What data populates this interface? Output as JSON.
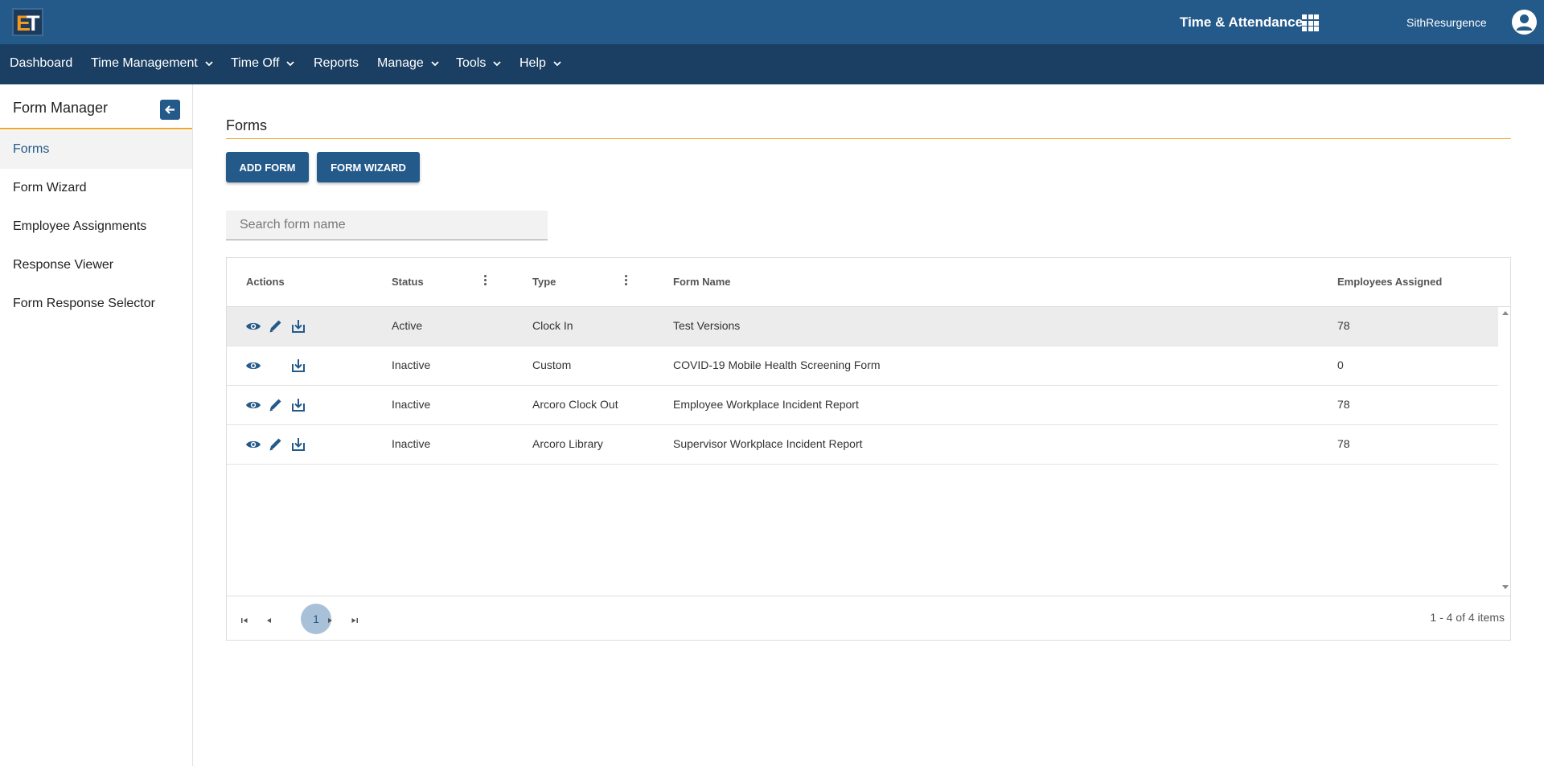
{
  "header": {
    "logo_text": "ET",
    "app_title": "Time & Attendance",
    "username": "SithResurgence"
  },
  "nav": {
    "items": [
      {
        "label": "Dashboard",
        "has_menu": false
      },
      {
        "label": "Time Management",
        "has_menu": true
      },
      {
        "label": "Time Off",
        "has_menu": true
      },
      {
        "label": "Reports",
        "has_menu": false
      },
      {
        "label": "Manage",
        "has_menu": true
      },
      {
        "label": "Tools",
        "has_menu": true
      },
      {
        "label": "Help",
        "has_menu": true
      }
    ]
  },
  "sidebar": {
    "title": "Form Manager",
    "items": [
      {
        "label": "Forms",
        "active": true
      },
      {
        "label": "Form Wizard",
        "active": false
      },
      {
        "label": "Employee Assignments",
        "active": false
      },
      {
        "label": "Response Viewer",
        "active": false
      },
      {
        "label": "Form Response Selector",
        "active": false
      }
    ]
  },
  "main": {
    "title": "Forms",
    "add_form_label": "ADD FORM",
    "form_wizard_label": "FORM WIZARD",
    "search_placeholder": "Search form name"
  },
  "table": {
    "columns": [
      "Actions",
      "Status",
      "Type",
      "Form Name",
      "Employees Assigned"
    ],
    "rows": [
      {
        "status": "Active",
        "type": "Clock In",
        "form_name": "Test Versions",
        "employees": "78",
        "editable": true
      },
      {
        "status": "Inactive",
        "type": "Custom",
        "form_name": "COVID-19 Mobile Health Screening Form",
        "employees": "0",
        "editable": false
      },
      {
        "status": "Inactive",
        "type": "Arcoro Clock Out",
        "form_name": "Employee Workplace Incident Report",
        "employees": "78",
        "editable": true
      },
      {
        "status": "Inactive",
        "type": "Arcoro Library",
        "form_name": "Supervisor Workplace Incident Report",
        "employees": "78",
        "editable": true
      }
    ]
  },
  "pager": {
    "current_page": "1",
    "info": "1 - 4 of 4 items"
  },
  "colors": {
    "header_bg": "#245a8a",
    "nav_bg": "#1a3f63",
    "accent": "#f0a72c",
    "button_bg": "#245a8a"
  }
}
